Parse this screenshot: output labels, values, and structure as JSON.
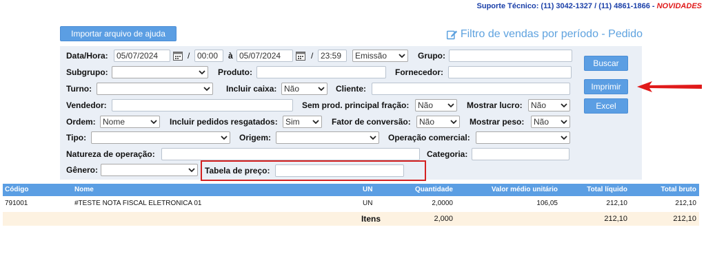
{
  "support": {
    "label": "Suporte Técnico: (11) 3042-1327 / (11) 4861-1866 - ",
    "novidades": "NOVIDADES"
  },
  "import_button": "Importar arquivo de ajuda",
  "page_title": "Filtro de vendas por período - Pedido",
  "filters": {
    "data_hora_label": "Data/Hora:",
    "date_from": "05/07/2024",
    "time_sep_1": "/",
    "time_from": "00:00",
    "ate_label": "à",
    "date_to": "05/07/2024",
    "time_sep_2": "/",
    "time_to": "23:59",
    "date_type": "Emissão",
    "grupo_label": "Grupo:",
    "grupo_value": "",
    "subgrupo_label": "Subgrupo:",
    "subgrupo_value": "",
    "produto_label": "Produto:",
    "produto_value": "",
    "fornecedor_label": "Fornecedor:",
    "fornecedor_value": "",
    "turno_label": "Turno:",
    "turno_value": "",
    "incluir_caixa_label": "Incluir caixa:",
    "incluir_caixa_value": "Não",
    "cliente_label": "Cliente:",
    "cliente_value": "",
    "vendedor_label": "Vendedor:",
    "vendedor_value": "",
    "sem_prod_label": "Sem prod. principal fração:",
    "sem_prod_value": "Não",
    "mostrar_lucro_label": "Mostrar lucro:",
    "mostrar_lucro_value": "Não",
    "ordem_label": "Ordem:",
    "ordem_value": "Nome",
    "incluir_resgatados_label": "Incluir pedidos resgatados:",
    "incluir_resgatados_value": "Sim",
    "fator_conversao_label": "Fator de conversão:",
    "fator_conversao_value": "Não",
    "mostrar_peso_label": "Mostrar peso:",
    "mostrar_peso_value": "Não",
    "tipo_label": "Tipo:",
    "tipo_value": "",
    "origem_label": "Origem:",
    "origem_value": "",
    "operacao_label": "Operação comercial:",
    "operacao_value": "",
    "natureza_label": "Natureza de operação:",
    "natureza_value": "",
    "categoria_label": "Categoria:",
    "categoria_value": "",
    "genero_label": "Gênero:",
    "genero_value": "",
    "tabela_preco_label": "Tabela de preço:",
    "tabela_preco_value": ""
  },
  "actions": {
    "buscar": "Buscar",
    "imprimir": "Imprimir",
    "excel": "Excel"
  },
  "table": {
    "headers": {
      "codigo": "Código",
      "nome": "Nome",
      "un": "UN",
      "quantidade": "Quantidade",
      "valor_medio": "Valor médio unitário",
      "total_liquido": "Total líquido",
      "total_bruto": "Total bruto"
    },
    "rows": [
      {
        "codigo": "791001",
        "nome": "#TESTE NOTA FISCAL ELETRONICA 01",
        "un": "UN",
        "quantidade": "2,0000",
        "valor_medio": "106,05",
        "total_liquido": "212,10",
        "total_bruto": "212,10"
      }
    ],
    "totals": {
      "label": "Itens",
      "quantidade": "2,000",
      "total_liquido": "212,10",
      "total_bruto": "212,10"
    }
  },
  "colors": {
    "accent_blue": "#5b9ee3",
    "support_blue": "#1a3fa8",
    "novidades_red": "#e01a1a",
    "annotation_red": "#d42020",
    "panel_bg": "#eaeff6",
    "totals_bg": "#fdf2e1"
  },
  "icons": [
    "edit-icon",
    "calendar-icon",
    "chevron-down-icon",
    "arrow-left-annotation"
  ]
}
